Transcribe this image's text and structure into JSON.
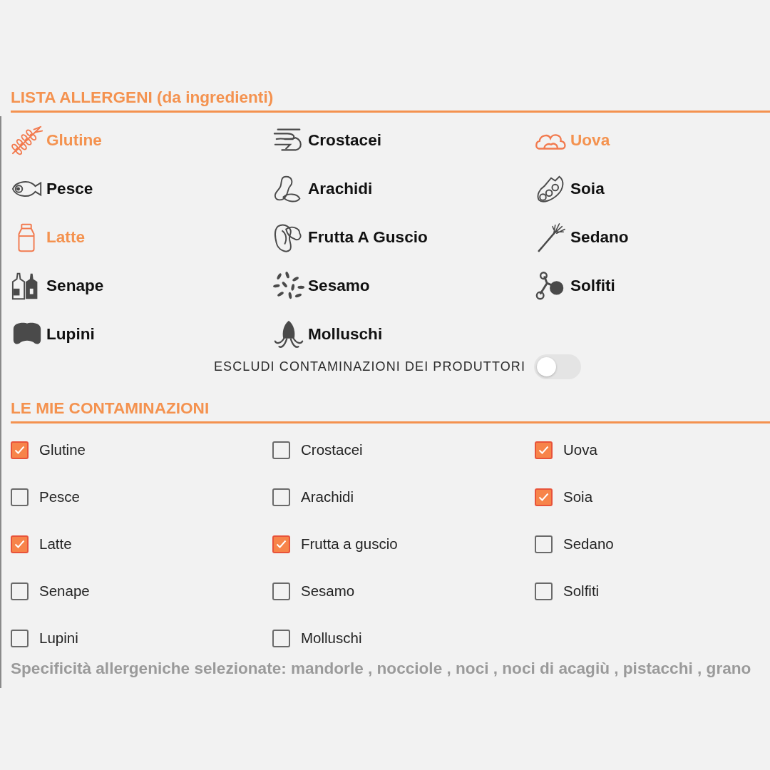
{
  "allergens_section": {
    "title": "LISTA ALLERGENI (da ingredienti)",
    "items": [
      {
        "label": "Glutine",
        "highlighted": true
      },
      {
        "label": "Crostacei",
        "highlighted": false
      },
      {
        "label": "Uova",
        "highlighted": true
      },
      {
        "label": "Pesce",
        "highlighted": false
      },
      {
        "label": "Arachidi",
        "highlighted": false
      },
      {
        "label": "Soia",
        "highlighted": false
      },
      {
        "label": "Latte",
        "highlighted": true
      },
      {
        "label": "Frutta A Guscio",
        "highlighted": false
      },
      {
        "label": "Sedano",
        "highlighted": false
      },
      {
        "label": "Senape",
        "highlighted": false
      },
      {
        "label": "Sesamo",
        "highlighted": false
      },
      {
        "label": "Solfiti",
        "highlighted": false
      },
      {
        "label": "Lupini",
        "highlighted": false
      },
      {
        "label": "Molluschi",
        "highlighted": false
      }
    ]
  },
  "exclude_toggle": {
    "label": "ESCLUDI CONTAMINAZIONI DEI PRODUTTORI",
    "on": false
  },
  "contaminations_section": {
    "title": "LE MIE CONTAMINAZIONI",
    "items": [
      {
        "label": "Glutine",
        "checked": true
      },
      {
        "label": "Crostacei",
        "checked": false
      },
      {
        "label": "Uova",
        "checked": true
      },
      {
        "label": "Pesce",
        "checked": false
      },
      {
        "label": "Arachidi",
        "checked": false
      },
      {
        "label": "Soia",
        "checked": true
      },
      {
        "label": "Latte",
        "checked": true
      },
      {
        "label": "Frutta a guscio",
        "checked": true
      },
      {
        "label": "Sedano",
        "checked": false
      },
      {
        "label": "Senape",
        "checked": false
      },
      {
        "label": "Sesamo",
        "checked": false
      },
      {
        "label": "Solfiti",
        "checked": false
      },
      {
        "label": "Lupini",
        "checked": false
      },
      {
        "label": "Molluschi",
        "checked": false
      }
    ]
  },
  "selected_specifics": "Specificità allergeniche selezionate: mandorle , nocciole , noci , noci di acagiù , pistacchi , grano"
}
